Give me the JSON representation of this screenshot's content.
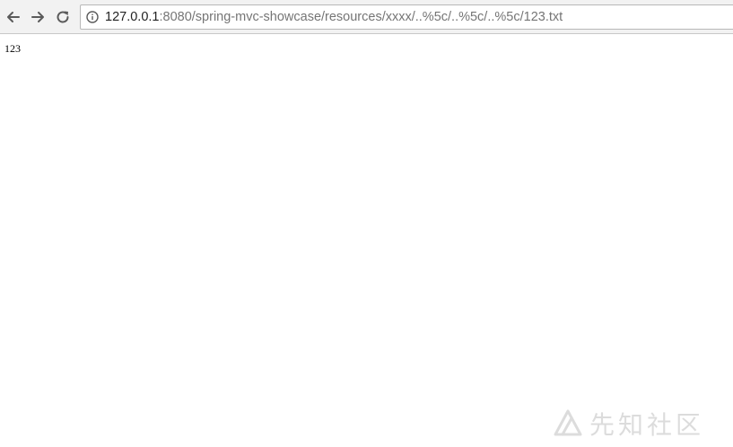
{
  "browser": {
    "back_icon": "arrow-left-icon",
    "forward_icon": "arrow-right-icon",
    "reload_icon": "reload-icon",
    "site_info_icon": "info-circle-icon",
    "url_host": "127.0.0.1",
    "url_rest": ":8080/spring-mvc-showcase/resources/xxxx/..%5c/..%5c/..%5c/123.txt"
  },
  "page": {
    "body_text": "123"
  },
  "watermark": {
    "text": "先知社区",
    "logo_icon": "xianzhi-logo-icon"
  }
}
